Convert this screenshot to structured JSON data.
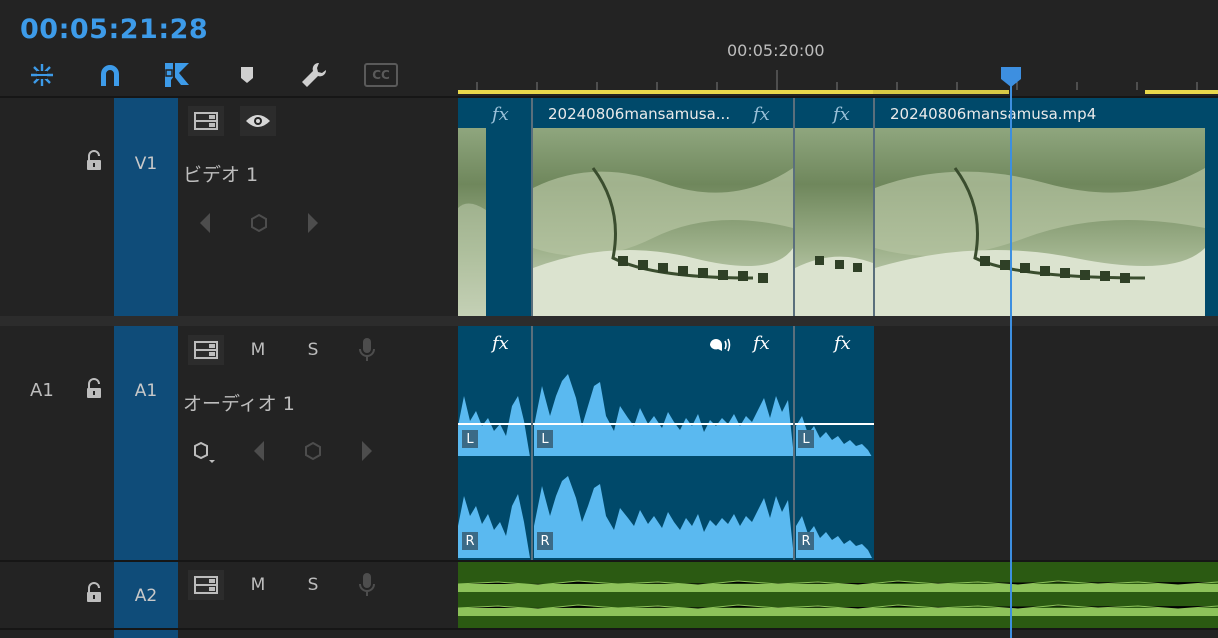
{
  "timecode": "00:05:21:28",
  "ruler": {
    "label": "00:05:20:00"
  },
  "toolbar": {
    "tools": [
      {
        "name": "snap-settings-icon",
        "color": "#3d9be9"
      },
      {
        "name": "magnet-icon",
        "color": "#3d9be9"
      },
      {
        "name": "linked-selection-icon",
        "color": "#3d9be9"
      },
      {
        "name": "marker-icon",
        "color": "#cfcfcf"
      },
      {
        "name": "wrench-icon",
        "color": "#cfcfcf"
      },
      {
        "name": "captions-icon",
        "color": "#5a5a5a"
      }
    ],
    "cc_label": "CC"
  },
  "tracks": {
    "v1": {
      "target": "V1",
      "name": "ビデオ 1"
    },
    "a1": {
      "source": "A1",
      "target": "A1",
      "name": "オーディオ 1",
      "mute": "M",
      "solo": "S"
    },
    "a2": {
      "target": "A2",
      "mute": "M",
      "solo": "S"
    }
  },
  "clips": {
    "video": [
      {
        "title": ""
      },
      {
        "title": "20240806mansamusa..."
      },
      {
        "title": ""
      },
      {
        "title": "20240806mansamusa.mp4"
      }
    ],
    "fx_label": "fx",
    "channel_left": "L",
    "channel_right": "R"
  },
  "colors": {
    "accent": "#3d9be9",
    "track_header": "#0f4c79",
    "clip": "#00496a",
    "waveform": "#5ab9f0",
    "a2_clip": "#2b5a12",
    "a2_wave": "#8dc25a",
    "render_bar": "#e9d84c"
  }
}
